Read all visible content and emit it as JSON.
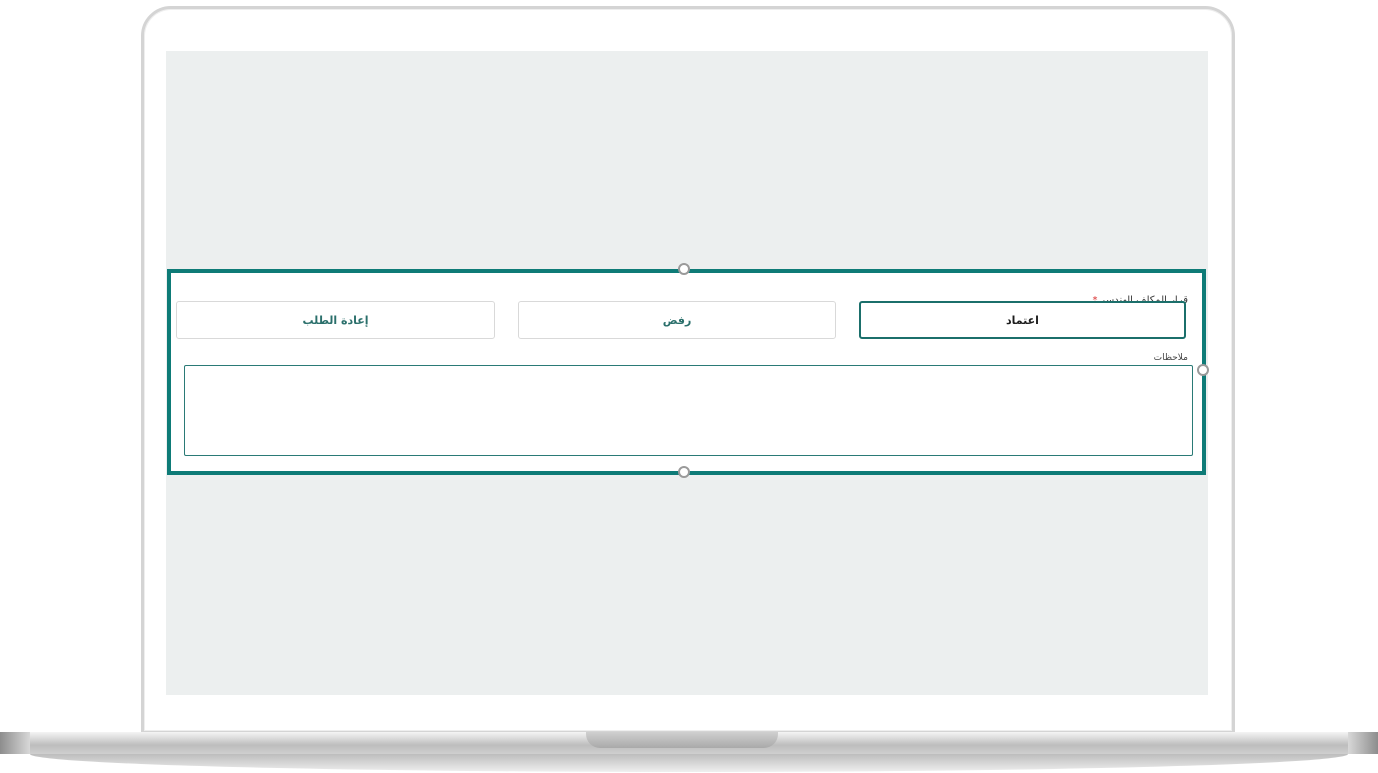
{
  "form": {
    "decision_label": "قرار المكلف الهندسي",
    "required_mark": "*",
    "options": {
      "approve": "اعتماد",
      "reject": "رفض",
      "return": "إعادة الطلب"
    },
    "selected_option": "approve",
    "notes_label": "ملاحظات",
    "notes_value": ""
  },
  "colors": {
    "highlight_border": "#0e7b77",
    "screen_background": "#ecefef",
    "required": "#d93030"
  }
}
